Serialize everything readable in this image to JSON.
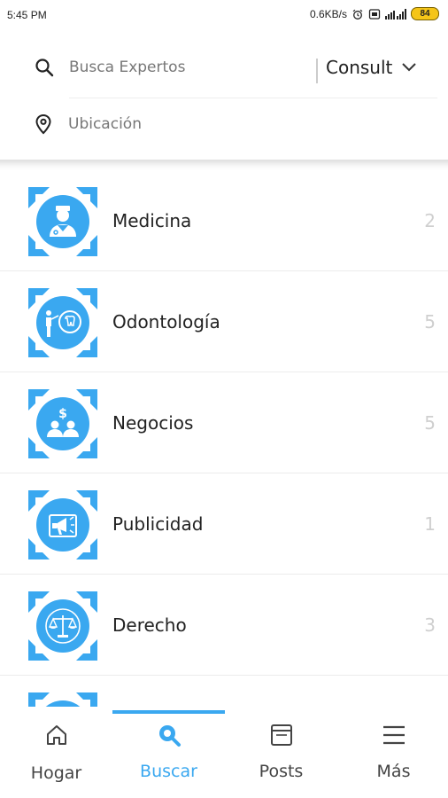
{
  "status_bar": {
    "time": "5:45 PM",
    "network_speed": "0.6KB/s",
    "battery": "84"
  },
  "search": {
    "placeholder": "Busca Expertos",
    "value": ""
  },
  "filter": {
    "label": "Consult"
  },
  "location": {
    "placeholder": "Ubicación",
    "value": ""
  },
  "categories": [
    {
      "label": "Medicina",
      "count": "2",
      "icon": "doctor-icon"
    },
    {
      "label": "Odontología",
      "count": "5",
      "icon": "dentist-icon"
    },
    {
      "label": "Negocios",
      "count": "5",
      "icon": "business-icon"
    },
    {
      "label": "Publicidad",
      "count": "1",
      "icon": "advertising-icon"
    },
    {
      "label": "Derecho",
      "count": "3",
      "icon": "law-scale-icon"
    }
  ],
  "bottom_nav": {
    "items": [
      {
        "label": "Hogar",
        "icon": "home-icon",
        "active": false
      },
      {
        "label": "Buscar",
        "icon": "search-icon",
        "active": true
      },
      {
        "label": "Posts",
        "icon": "posts-icon",
        "active": false
      },
      {
        "label": "Más",
        "icon": "menu-icon",
        "active": false
      }
    ]
  },
  "colors": {
    "accent": "#3aa8f0",
    "count_text": "#cfcfcf",
    "divider": "#ececec"
  }
}
